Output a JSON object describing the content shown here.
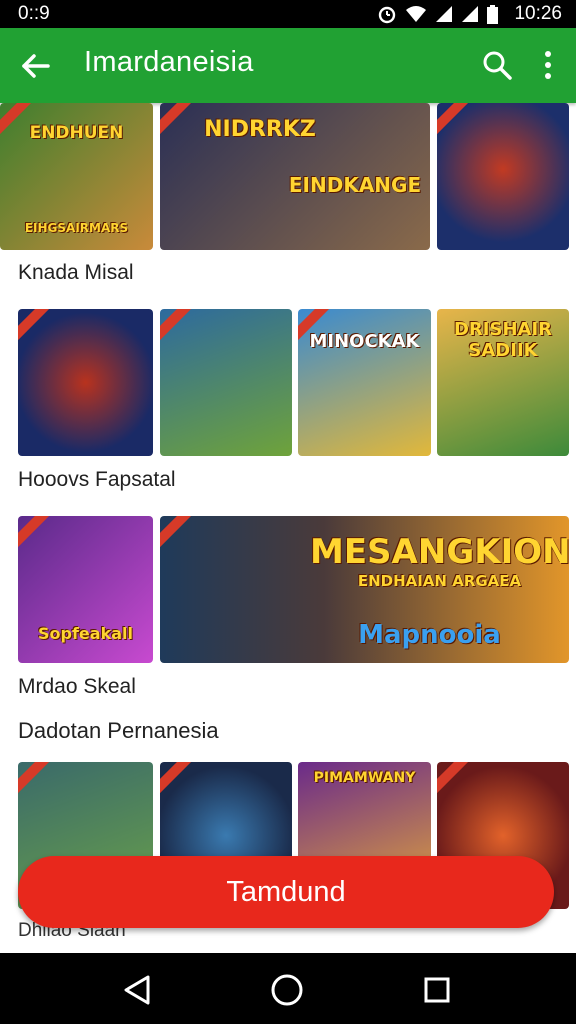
{
  "status_bar": {
    "time_left": "0::9",
    "time_right": "10:26",
    "icons": [
      "alarm-icon",
      "wifi-icon",
      "signal-icon",
      "signal-icon",
      "battery-icon"
    ]
  },
  "app_bar": {
    "title": "Imardaneisia",
    "back_icon": "arrow-back-icon",
    "search_icon": "search-icon",
    "more_icon": "more-vert-icon"
  },
  "rows": [
    {
      "label": "Knada Misal",
      "tiles": [
        {
          "name": "game-tile-1",
          "text": "ENDHUEN",
          "subtext": "EIHGSAIRMARS",
          "colors": [
            "#3e7f2e",
            "#c98a3a"
          ]
        },
        {
          "name": "game-tile-2",
          "text": "NIDRRKZ",
          "subtext": "EINDKANGE",
          "colors": [
            "#2a2f55",
            "#8a6a4a"
          ]
        },
        {
          "name": "game-tile-3",
          "text": "",
          "subtext": "",
          "colors": [
            "#1c2f6b",
            "#c23a22"
          ]
        }
      ]
    },
    {
      "label": "Hooovs Fapsatal",
      "tiles": [
        {
          "name": "game-tile-4",
          "text": "",
          "subtext": "",
          "colors": [
            "#1a2a66",
            "#b8321e"
          ]
        },
        {
          "name": "game-tile-5",
          "text": "",
          "subtext": "",
          "colors": [
            "#2d6a9e",
            "#6fa33a"
          ]
        },
        {
          "name": "game-tile-6",
          "text": "MINOCKAK",
          "subtext": "",
          "colors": [
            "#3a8ad0",
            "#e2b83a"
          ]
        },
        {
          "name": "game-tile-7",
          "text": "DRISHAIR SADIIK",
          "subtext": "",
          "colors": [
            "#e8b54a",
            "#3d8a3a"
          ]
        }
      ]
    },
    {
      "label": "Mrdao Skeal",
      "tiles": [
        {
          "name": "game-tile-8",
          "text": "Sopfeakall",
          "subtext": "",
          "colors": [
            "#5a2a8a",
            "#c84ad0"
          ]
        },
        {
          "name": "game-tile-9",
          "text": "MESANGKION",
          "subtext": "ENDHAIAN ARGAEA",
          "text2": "Mapnooia",
          "colors": [
            "#1f3a5a",
            "#e2962a"
          ]
        }
      ]
    },
    {
      "label": "Dhilao Slaan",
      "tiles": [
        {
          "name": "game-tile-10",
          "text": "",
          "subtext": "",
          "colors": [
            "#3a6a6a",
            "#6aa14a"
          ]
        },
        {
          "name": "game-tile-11",
          "text": "",
          "subtext": "",
          "colors": [
            "#1a2a4a",
            "#3a7ab0"
          ]
        },
        {
          "name": "game-tile-12",
          "text": "PIMAMWANY",
          "subtext": "",
          "colors": [
            "#6a2a8a",
            "#e4a83a"
          ]
        },
        {
          "name": "game-tile-13",
          "text": "",
          "subtext": "",
          "colors": [
            "#6a1a1a",
            "#e2622a"
          ]
        }
      ]
    }
  ],
  "section_header": "Dadotan Pernanesia",
  "fab": {
    "label": "Tamdund"
  },
  "nav_bar": {
    "icons": [
      "back-nav-icon",
      "home-nav-icon",
      "recents-nav-icon"
    ]
  }
}
